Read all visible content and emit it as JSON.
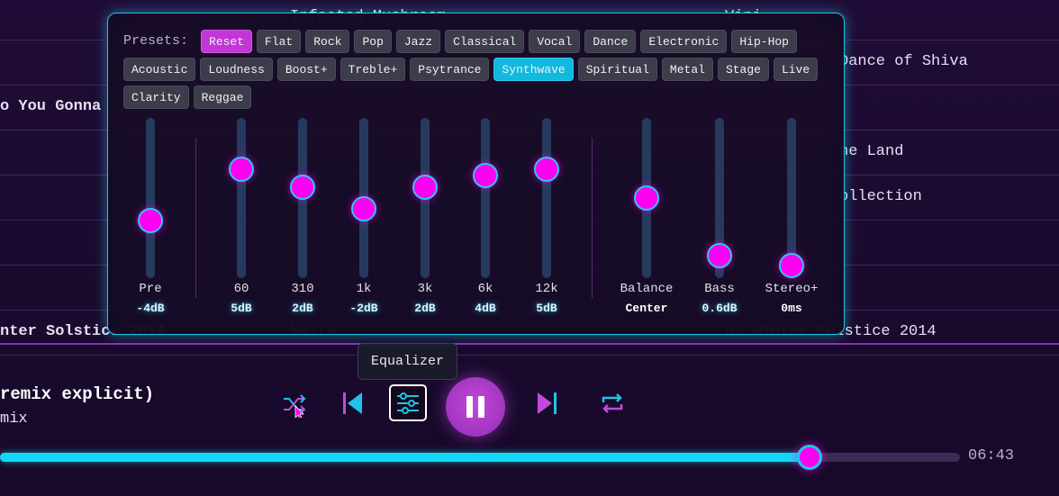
{
  "background_rows": [
    {
      "left": "",
      "mid": "Infected Mushroom",
      "right": "Vini"
    },
    {
      "left": "",
      "mid": "",
      "right": "Dance of Shiva"
    },
    {
      "left": "o You Gonna",
      "mid": "",
      "right": ""
    },
    {
      "left": "",
      "mid": "",
      "right": "he Land"
    },
    {
      "left": "",
      "mid": "",
      "right": "ollection"
    },
    {
      "left": "",
      "mid": "",
      "right": ""
    },
    {
      "left": "",
      "mid": "",
      "right": ""
    },
    {
      "left": "nter Solstice 2014",
      "mid": "Naita",
      "right": "DJ Winter Solstice 2014"
    }
  ],
  "now_playing": {
    "title": " remix explicit)",
    "subtitle": "mix"
  },
  "tooltip": "Equalizer",
  "controls": {
    "shuffle_icon": "shuffle-icon",
    "prev_icon": "skip-previous-icon",
    "eq_icon": "equalizer-icon",
    "play_icon": "pause-icon",
    "next_icon": "skip-next-icon",
    "repeat_icon": "repeat-icon"
  },
  "progress": {
    "fraction": 0.843,
    "time_right": "06:43"
  },
  "equalizer": {
    "presets_label": "Presets:",
    "presets": [
      "Reset",
      "Flat",
      "Rock",
      "Pop",
      "Jazz",
      "Classical",
      "Vocal",
      "Dance",
      "Electronic",
      "Hip-Hop",
      "Acoustic",
      "Loudness",
      "Boost+",
      "Treble+",
      "Psytrance",
      "Synthwave",
      "Spiritual",
      "Metal",
      "Stage",
      "Live",
      "Clarity",
      "Reggae"
    ],
    "reset_preset": "Reset",
    "active_preset": "Synthwave",
    "sliders": [
      {
        "label": "Pre",
        "value": "-4dB",
        "level": 0.36
      },
      {
        "label": "60",
        "value": "5dB",
        "level": 0.68
      },
      {
        "label": "310",
        "value": "2dB",
        "level": 0.57
      },
      {
        "label": "1k",
        "value": "-2dB",
        "level": 0.43
      },
      {
        "label": "3k",
        "value": "2dB",
        "level": 0.57
      },
      {
        "label": "6k",
        "value": "4dB",
        "level": 0.64
      },
      {
        "label": "12k",
        "value": "5dB",
        "level": 0.68
      },
      {
        "label": "Balance",
        "value": "Center",
        "level": 0.5
      },
      {
        "label": "Bass",
        "value": "0.6dB",
        "level": 0.14
      },
      {
        "label": "Stereo+",
        "value": "0ms",
        "level": 0.08
      }
    ]
  },
  "colors": {
    "accent_cyan": "#12d8f4",
    "accent_magenta": "#ff00f0",
    "accent_purple": "#a035c0"
  }
}
